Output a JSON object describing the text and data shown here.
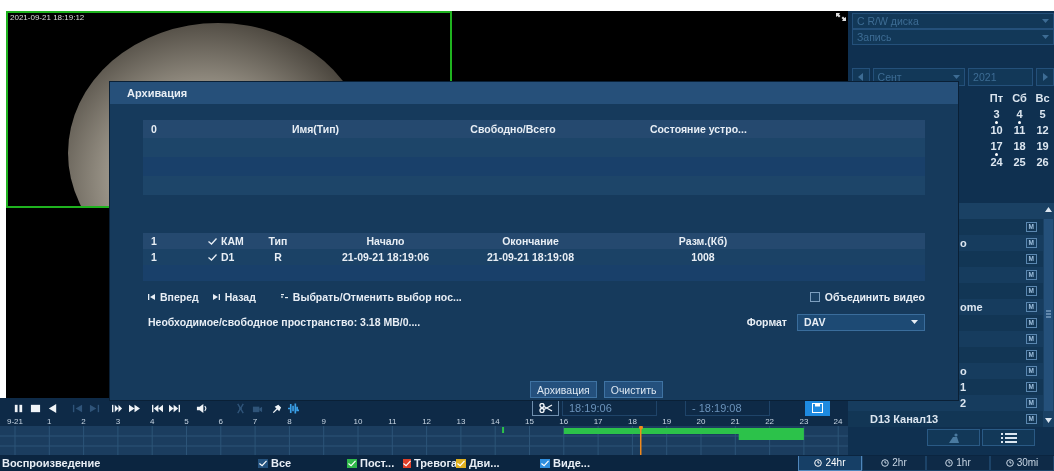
{
  "video": {
    "timestamp": "2021-09-21 18:19:12"
  },
  "side_panel": {
    "disk_select": "C R/W диска",
    "record_select": "Запись",
    "month": "Сент",
    "year": "2021",
    "weekdays": [
      "Пт",
      "Сб",
      "Вс"
    ],
    "days": [
      {
        "label": "3",
        "has_record": true
      },
      {
        "label": "4",
        "has_record": true
      },
      {
        "label": "5",
        "has_record": false
      },
      {
        "label": "10",
        "has_record": false
      },
      {
        "label": "11",
        "has_record": false
      },
      {
        "label": "12",
        "has_record": false
      },
      {
        "label": "17",
        "has_record": true
      },
      {
        "label": "18",
        "has_record": false
      },
      {
        "label": "19",
        "has_record": false
      },
      {
        "label": "24",
        "has_record": false
      },
      {
        "label": "25",
        "has_record": false
      },
      {
        "label": "26",
        "has_record": false
      }
    ],
    "channels": [
      {
        "badge": "M"
      },
      {
        "label": "o",
        "kind": "cut",
        "badge": "M"
      },
      {
        "badge": "M"
      },
      {
        "badge": "M"
      },
      {
        "badge": "M"
      },
      {
        "label": "ome",
        "kind": "cut",
        "badge": "M"
      },
      {
        "badge": "M"
      },
      {
        "badge": "M"
      },
      {
        "badge": "M"
      },
      {
        "label": "o",
        "kind": "cut",
        "badge": "M"
      },
      {
        "label": "1",
        "kind": "cut",
        "badge": "M"
      },
      {
        "label": "2",
        "kind": "cut",
        "badge": "M"
      },
      {
        "label": "D13 Канал13",
        "kind": "whole",
        "badge": "M"
      }
    ]
  },
  "dialog": {
    "title": "Архивация",
    "device_columns": [
      "0",
      "Имя(Тип)",
      "Свободно/Всего",
      "Состояние устро..."
    ],
    "file_header": {
      "index": "1",
      "checked": true,
      "camera": "КАМ",
      "type": "Тип",
      "start": "Начало",
      "end": "Окончание",
      "size": "Разм.(Кб)"
    },
    "files": [
      {
        "index": "1",
        "checked": true,
        "camera": "D1",
        "type": "R",
        "start": "21-09-21 18:19:06",
        "end": "21-09-21 18:19:08",
        "size": "1008"
      }
    ],
    "actions": [
      {
        "kind": "first",
        "label": "Вперед"
      },
      {
        "kind": "last",
        "label": "Назад"
      },
      {
        "kind": "select",
        "label": "Выбрать/Отменить выбор нос..."
      }
    ],
    "merge": {
      "label": "Объединить видео",
      "checked": false
    },
    "space": "Необходимое/свободное пространство: 3.18 MB/0....",
    "format": {
      "label": "Формат",
      "value": "DAV"
    },
    "buttons": [
      "Архивация",
      "Очистить"
    ]
  },
  "playback": {
    "controls": [
      {
        "kind": "pause",
        "disabled": false
      },
      {
        "kind": "stop",
        "disabled": false
      },
      {
        "kind": "reverse",
        "disabled": false
      },
      {
        "kind": "step-back",
        "disabled": true
      },
      {
        "kind": "step-forward",
        "disabled": true
      },
      {
        "kind": "slow",
        "disabled": false
      },
      {
        "kind": "fast",
        "disabled": false
      },
      {
        "kind": "previous",
        "disabled": false
      },
      {
        "kind": "next",
        "disabled": false
      },
      {
        "kind": "volume",
        "disabled": false
      },
      {
        "kind": "mark",
        "disabled": true
      },
      {
        "kind": "smart",
        "disabled": true
      },
      {
        "kind": "pin",
        "disabled": false
      },
      {
        "kind": "wave",
        "disabled": false
      }
    ],
    "clip_start": "18:19:06",
    "clip_end": "- 18:19:08"
  },
  "timeline": {
    "labels": [
      "9-21",
      "1",
      "2",
      "3",
      "4",
      "5",
      "6",
      "7",
      "8",
      "9",
      "10",
      "11",
      "12",
      "13",
      "14",
      "15",
      "16",
      "17",
      "18",
      "19",
      "20",
      "21",
      "22",
      "23",
      "24"
    ]
  },
  "status_bar": {
    "title": "Воспроизведение",
    "filters": [
      {
        "label": "Все",
        "checked": true,
        "color": "#24527e"
      },
      {
        "label": "Пост...",
        "checked": true,
        "color": "#2fb84a"
      },
      {
        "label": "Тревога",
        "checked": true,
        "color": "#e0402a"
      },
      {
        "label": "Дви...",
        "checked": true,
        "color": "#e0b020"
      },
      {
        "label": "Виде...",
        "checked": true,
        "color": "#2f8fe0"
      }
    ],
    "scales": [
      {
        "label": "24hr",
        "selected": true
      },
      {
        "label": "2hr",
        "selected": false
      },
      {
        "label": "1hr",
        "selected": false
      },
      {
        "label": "30mi",
        "selected": false
      }
    ]
  }
}
